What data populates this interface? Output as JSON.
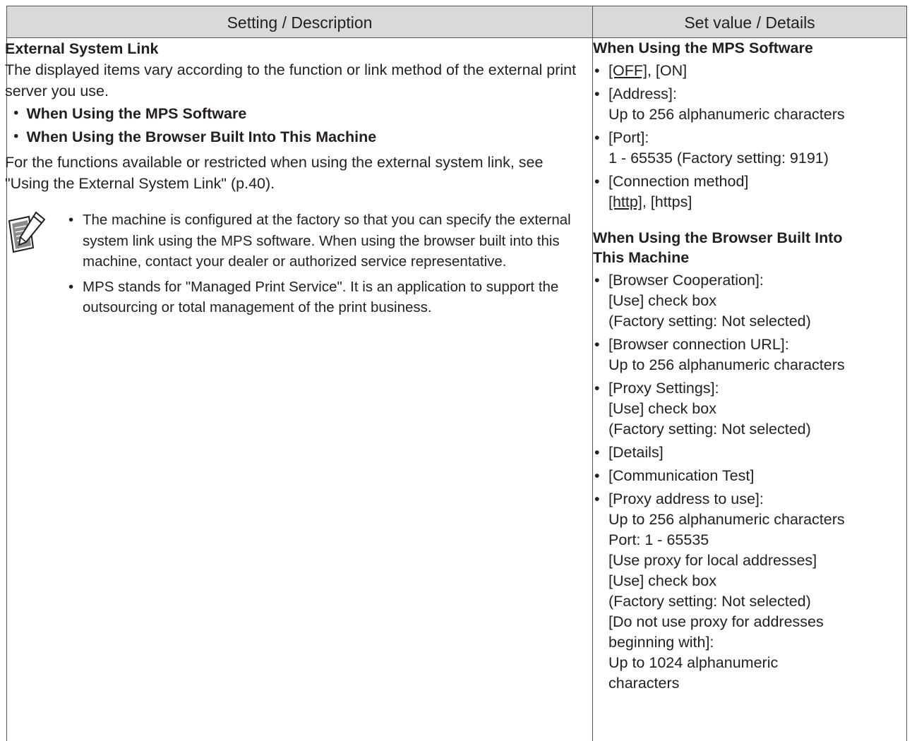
{
  "header": {
    "col1": "Setting / Description",
    "col2": "Set value / Details"
  },
  "left": {
    "title": "External System Link",
    "intro": "The displayed items vary according to the function or link method of the external print server you use.",
    "subitems": [
      "When Using the MPS Software",
      "When Using the Browser Built Into This Machine"
    ],
    "bullet_mark": "・",
    "functions_text": "For the functions available or restricted when using the external system link, see \"Using the External System Link\" (p.40).",
    "note_icon": "pencil-note-icon",
    "notes": [
      "The machine is configured at the factory so that you can specify the external system link using the MPS software. When using the browser built into this machine, contact your dealer or authorized service representative.",
      "MPS stands for \"Managed Print Service\". It is an application to support the outsourcing or total management of the print business."
    ]
  },
  "right": {
    "mps": {
      "title": "When Using the MPS Software",
      "onoff": {
        "default": "[OFF]",
        "rest": ", [ON]"
      },
      "address_label": "[Address]:",
      "address_value": "Up to 256 alphanumeric characters",
      "port_label": "[Port]:",
      "port_value": "1 - 65535 (Factory setting: 9191)",
      "conn_label": "[Connection method]",
      "conn": {
        "default": "[http]",
        "rest": ", [https]"
      }
    },
    "browser": {
      "title_line1": "When Using the Browser Built Into",
      "title_line2": "This Machine",
      "coop_label": "[Browser Cooperation]:",
      "coop_check": "[Use] check box",
      "coop_factory": "(Factory setting: Not selected)",
      "url_label": "[Browser connection URL]:",
      "url_value": "Up to 256 alphanumeric characters",
      "proxy_label": "[Proxy Settings]:",
      "proxy_check": "[Use] check box",
      "proxy_factory": "(Factory setting: Not selected)",
      "details": "[Details]",
      "comm_test": "[Communication Test]",
      "proxy_addr_label": "[Proxy address to use]:",
      "proxy_addr_value": "Up to 256 alphanumeric characters",
      "proxy_port": "Port: 1 - 65535",
      "local_label": "[Use proxy for local addresses]",
      "local_check": "[Use] check box",
      "local_factory": "(Factory setting: Not selected)",
      "noproxy_line1": "[Do not use proxy for addresses",
      "noproxy_line2": "beginning with]:",
      "noproxy_value_line1": "Up to 1024 alphanumeric",
      "noproxy_value_line2": "characters"
    }
  }
}
